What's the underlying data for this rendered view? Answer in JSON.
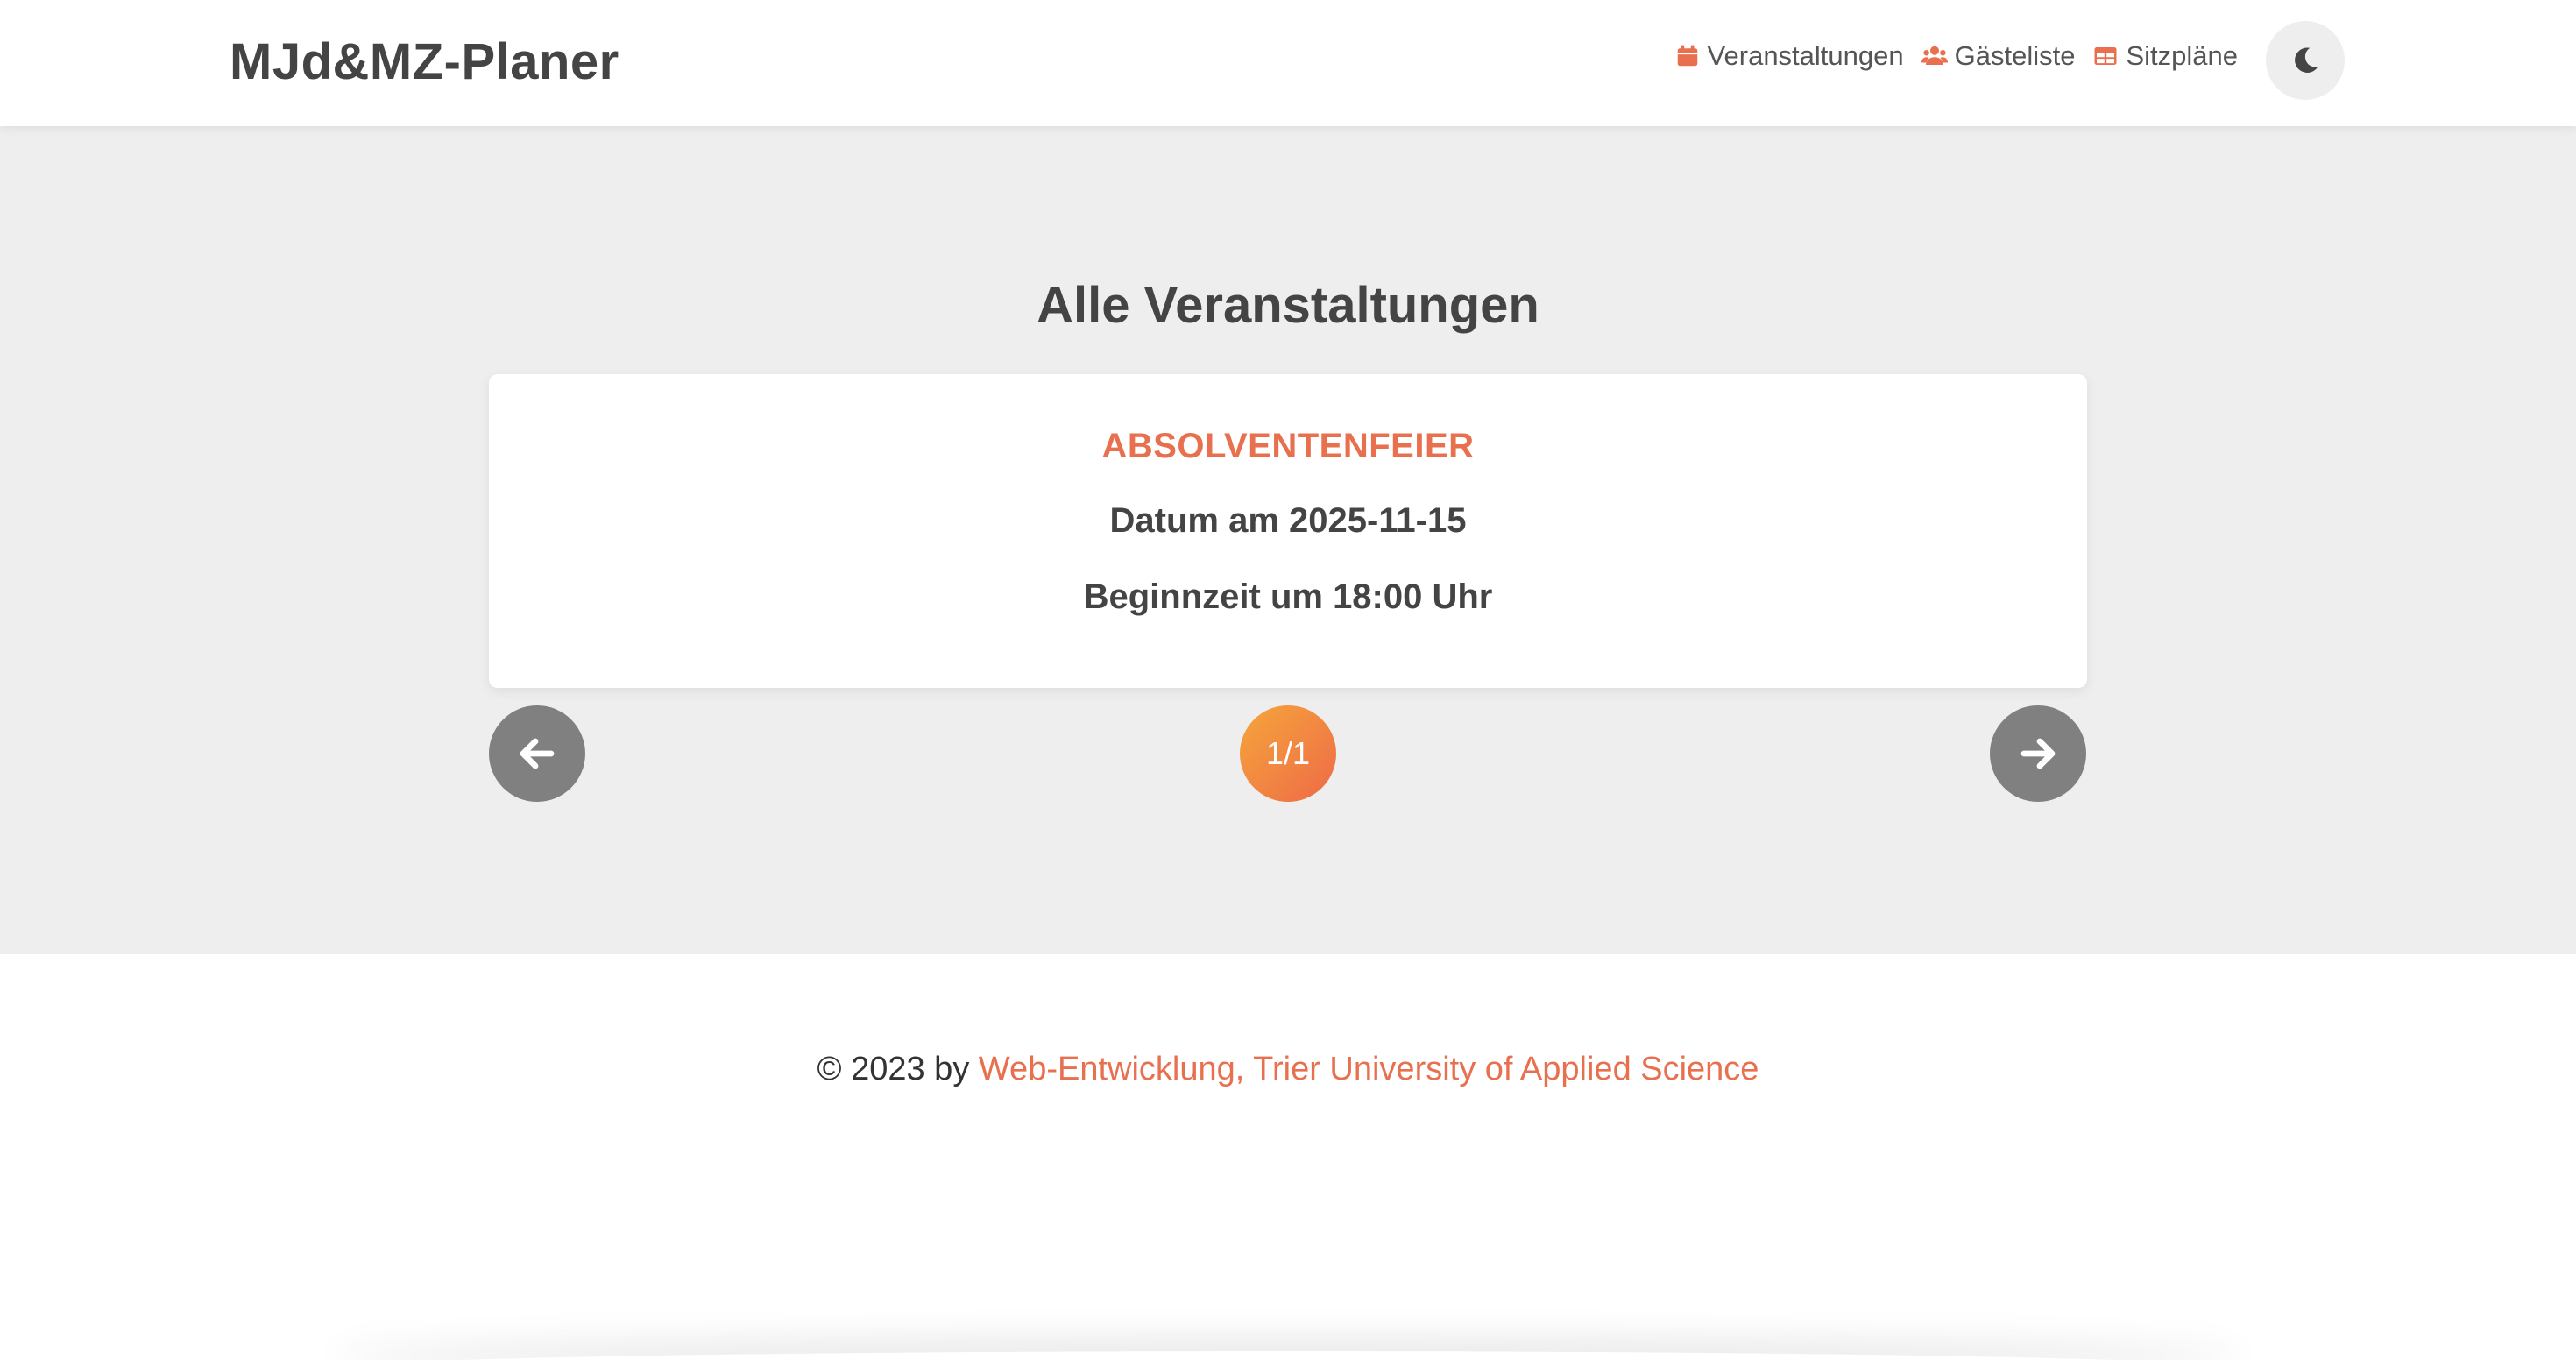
{
  "header": {
    "brand": "MJd&MZ-Planer",
    "nav": [
      {
        "label": "Veranstaltungen",
        "icon": "calendar-icon"
      },
      {
        "label": "Gästeliste",
        "icon": "users-icon"
      },
      {
        "label": "Sitzpläne",
        "icon": "table-icon"
      }
    ],
    "theme_toggle_icon": "moon-icon"
  },
  "main": {
    "title": "Alle Veranstaltungen",
    "event": {
      "name": "ABSOLVENTENFEIER",
      "date": "Datum am 2025-11-15",
      "time": "Beginnzeit um 18:00 Uhr"
    },
    "pagination": {
      "indicator": "1/1",
      "prev_icon": "arrow-left-icon",
      "next_icon": "arrow-right-icon"
    }
  },
  "footer": {
    "prefix": "© 2023 by ",
    "link": "Web-Entwicklung, Trier University of Applied Science"
  },
  "colors": {
    "accent": "#e8704f",
    "gradient_start": "#f5a63c",
    "gradient_end": "#ee6a47",
    "nav_button": "#808080",
    "background": "#eeeeee",
    "text": "#444444"
  }
}
